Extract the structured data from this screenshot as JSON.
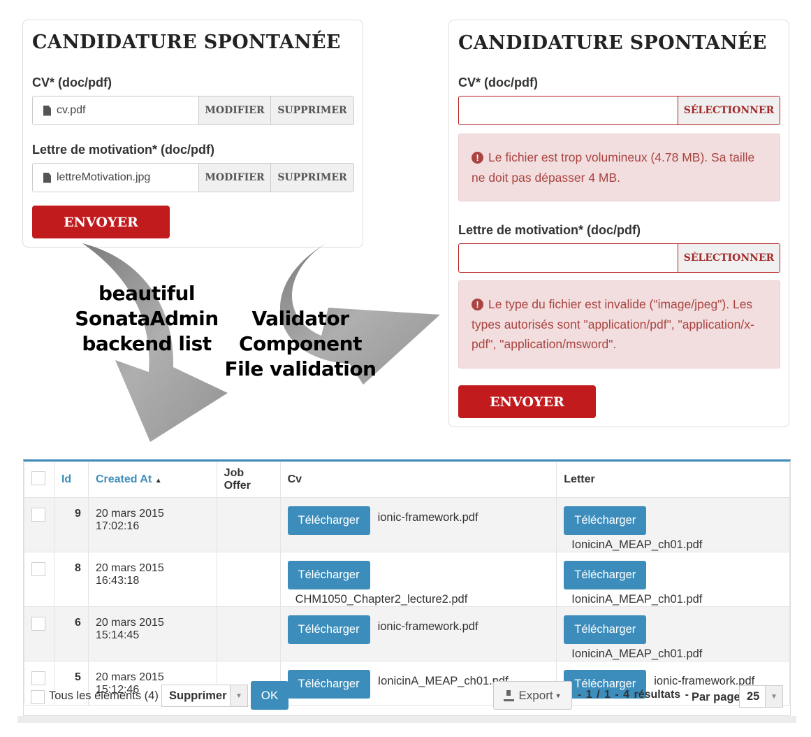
{
  "form_valid": {
    "title": "CANDIDATURE SPONTANÉE",
    "cv_label": "CV* (doc/pdf)",
    "cv_file": "cv.pdf",
    "letter_label": "Lettre de motivation* (doc/pdf)",
    "letter_file": "lettreMotivation.jpg",
    "modify_label": "MODIFIER",
    "delete_label": "SUPPRIMER",
    "submit_label": "ENVOYER"
  },
  "form_errors": {
    "title": "CANDIDATURE SPONTANÉE",
    "cv_label": "CV* (doc/pdf)",
    "select_label": "SÉLECTIONNER",
    "cv_error": "Le fichier est trop volumineux (4.78 MB). Sa taille ne doit pas dépasser 4 MB.",
    "letter_label": "Lettre de motivation* (doc/pdf)",
    "letter_error": "Le type du fichier est invalide (\"image/jpeg\"). Les types autorisés sont \"application/pdf\", \"application/x-pdf\", \"application/msword\".",
    "submit_label": "ENVOYER"
  },
  "annotations": {
    "left_lines": [
      "beautiful",
      "SonataAdmin",
      "backend list"
    ],
    "right_lines": [
      "Validator",
      "Component",
      "File validation"
    ]
  },
  "list": {
    "columns": {
      "id": "Id",
      "created_at": "Created At",
      "job_offer": "Job Offer",
      "cv": "Cv",
      "letter": "Letter"
    },
    "sort_indicator": "▲",
    "download_label": "Télécharger",
    "rows": [
      {
        "id": "9",
        "created_at": "20 mars 2015 17:02:16",
        "job_offer": "",
        "cv": "ionic-framework.pdf",
        "letter": "IonicinA_MEAP_ch01.pdf"
      },
      {
        "id": "8",
        "created_at": "20 mars 2015 16:43:18",
        "job_offer": "",
        "cv": "CHM1050_Chapter2_lecture2.pdf",
        "letter": "IonicinA_MEAP_ch01.pdf"
      },
      {
        "id": "6",
        "created_at": "20 mars 2015 15:14:45",
        "job_offer": "",
        "cv": "ionic-framework.pdf",
        "letter": "IonicinA_MEAP_ch01.pdf"
      },
      {
        "id": "5",
        "created_at": "20 mars 2015 15:12:46",
        "job_offer": "",
        "cv": "IonicinA_MEAP_ch01.pdf",
        "letter": "ionic-framework.pdf"
      }
    ],
    "footer": {
      "all_elements": "Tous les éléments (4)",
      "batch_action": "Supprimer",
      "ok_label": "OK",
      "export_label": "Export",
      "pagination": "- 1 / 1 - 4 résultats -",
      "per_page_label": "Par page",
      "per_page_value": "25"
    }
  },
  "colors": {
    "brand_red": "#c21b1e",
    "error_text": "#a94442",
    "error_bg": "#f2dede",
    "admin_blue": "#3c8dbc"
  }
}
